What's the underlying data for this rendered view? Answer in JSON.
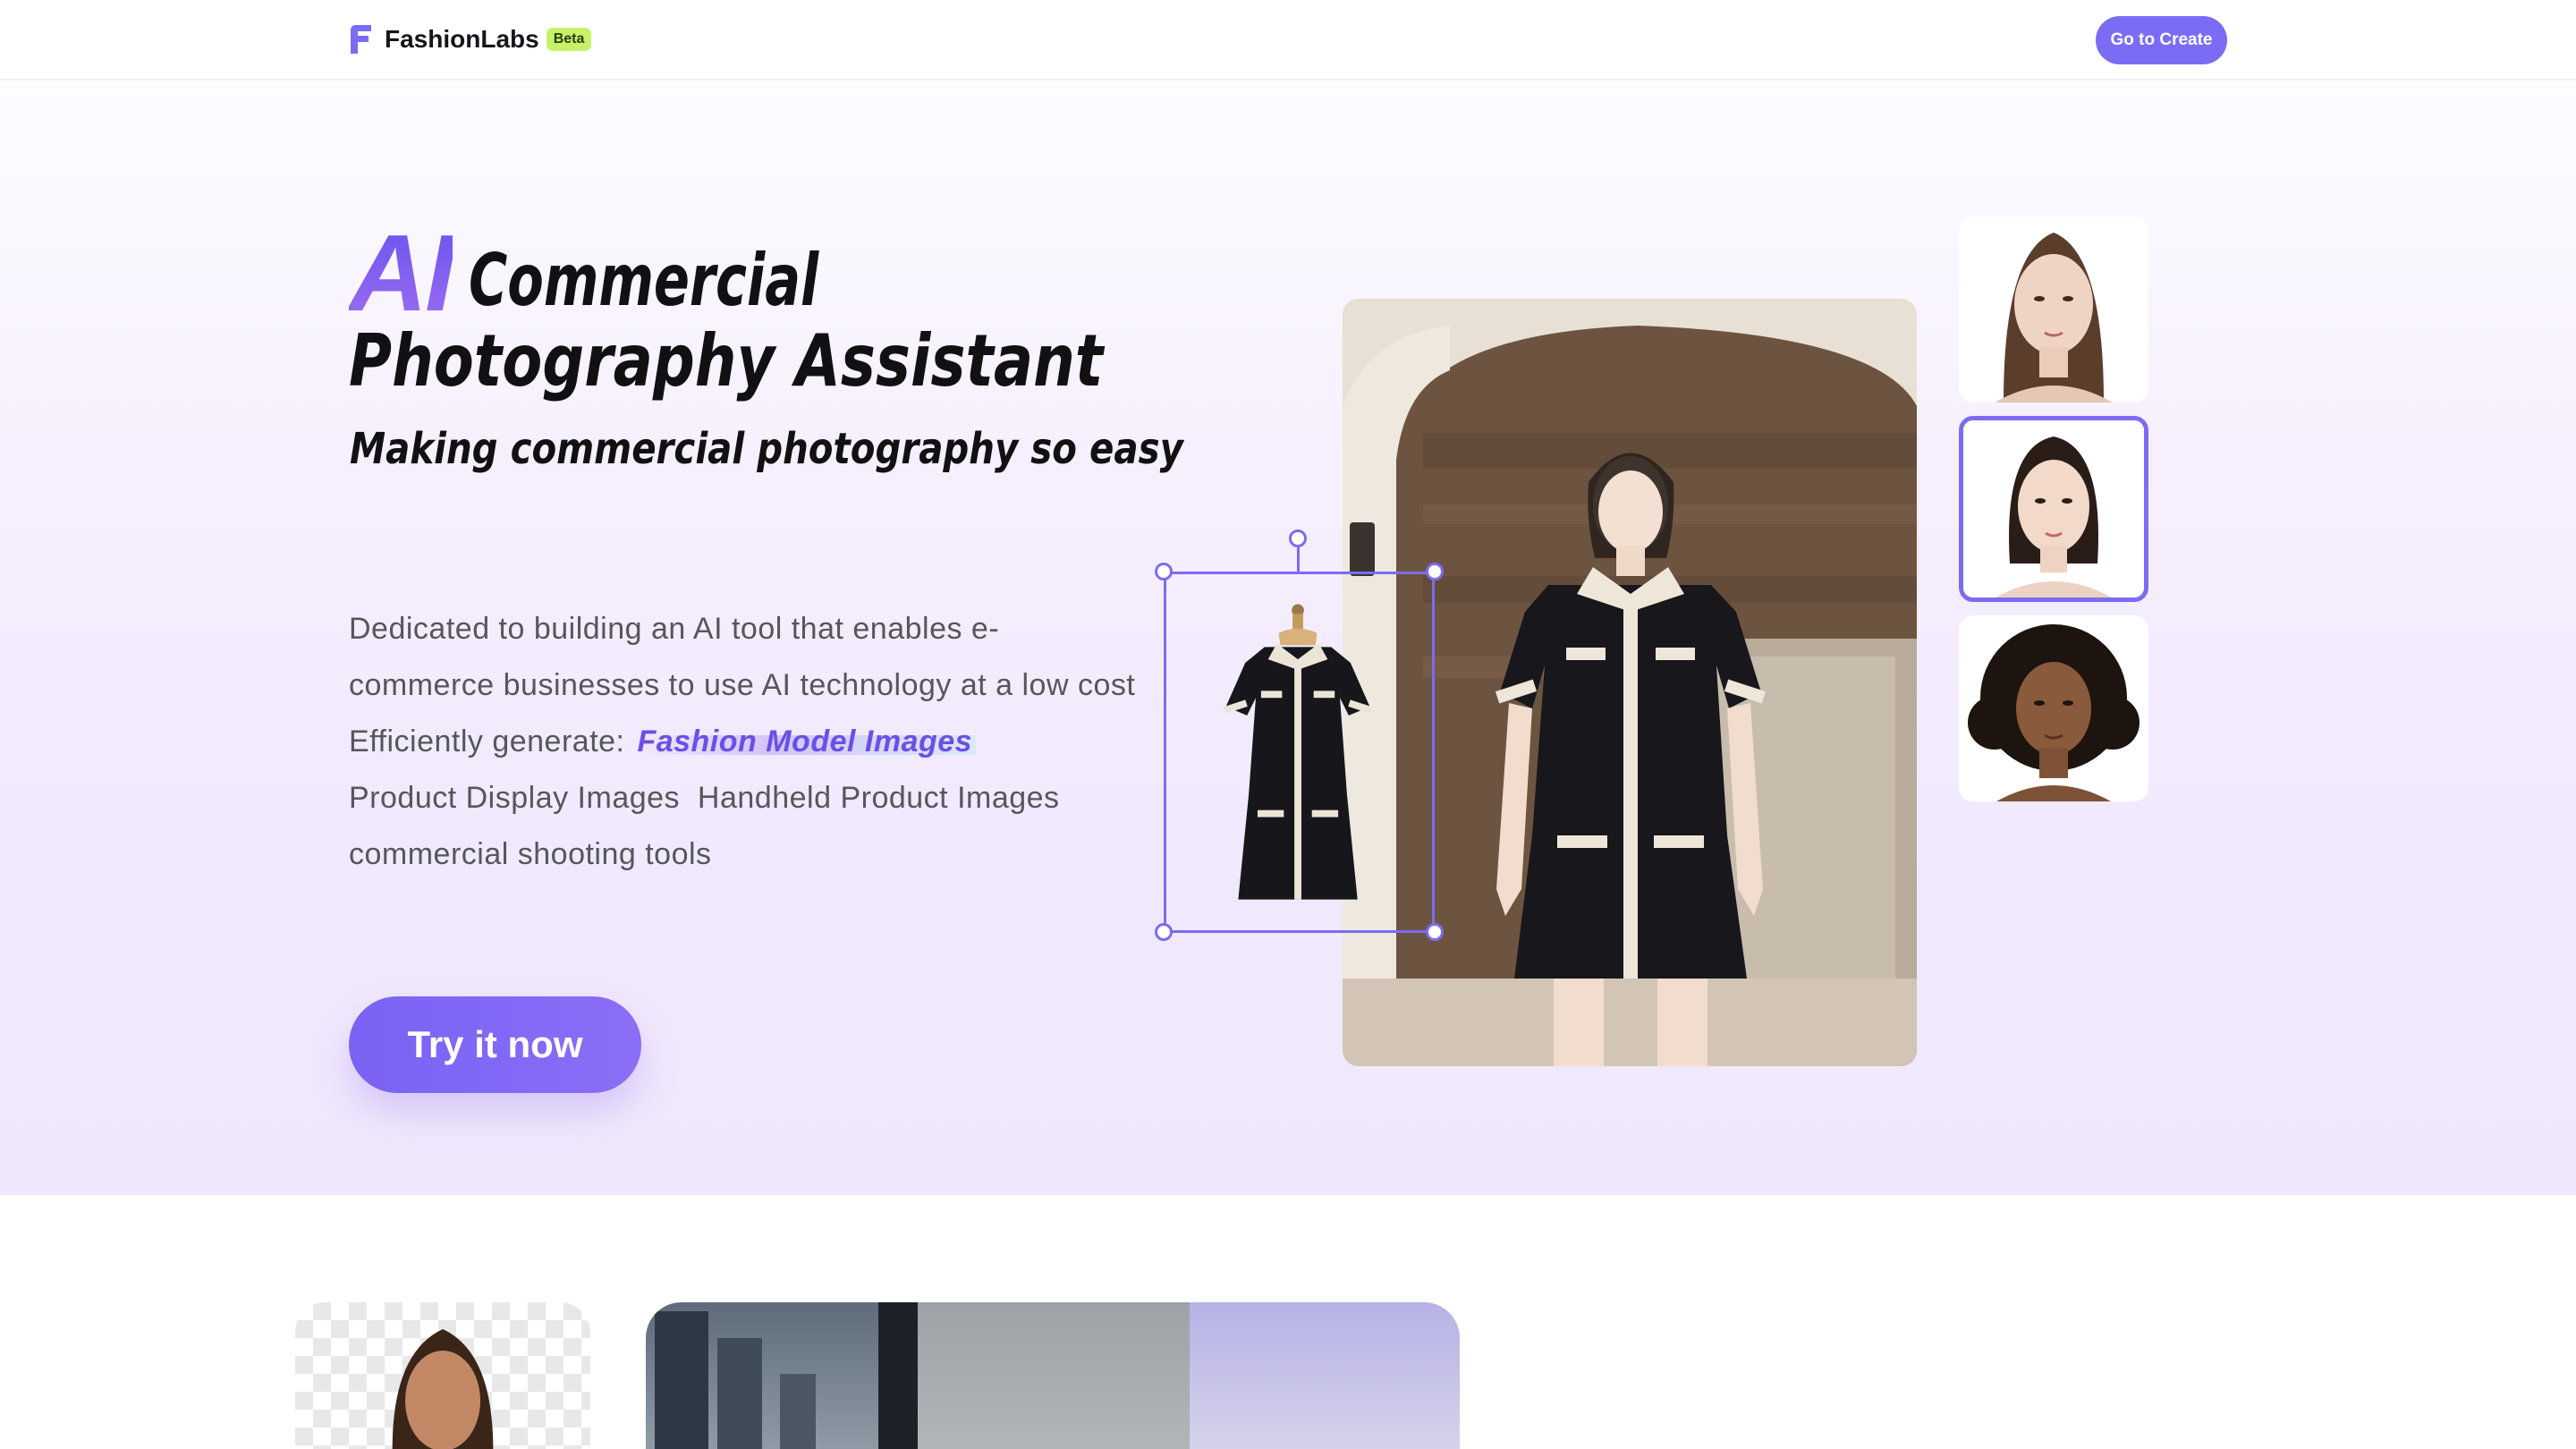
{
  "header": {
    "brand": "FashionLabs",
    "badge": "Beta",
    "cta_label": "Go to Create"
  },
  "hero": {
    "headline_ai": "AI",
    "headline_line1_rest": "Commercial",
    "headline_line2": "Photography Assistant",
    "subtitle": "Making commercial photography so easy",
    "description": "Dedicated to building an AI tool that enables e-commerce businesses to use AI technology at a low cost",
    "generate_prefix": "Efficiently generate: ",
    "generate_highlight": "Fashion Model Images",
    "generate_items_line": "Product Display Images  Handheld Product Images",
    "generate_items_line2": "commercial shooting tools",
    "try_label": "Try it now"
  },
  "showcase": {
    "selected_model_index": 1,
    "model_thumbnails": [
      "model-a",
      "model-b",
      "model-c"
    ]
  },
  "colors": {
    "accent": "#7b6cf6",
    "badge": "#c6f26b",
    "highlight_text": "#6b4fe6"
  }
}
